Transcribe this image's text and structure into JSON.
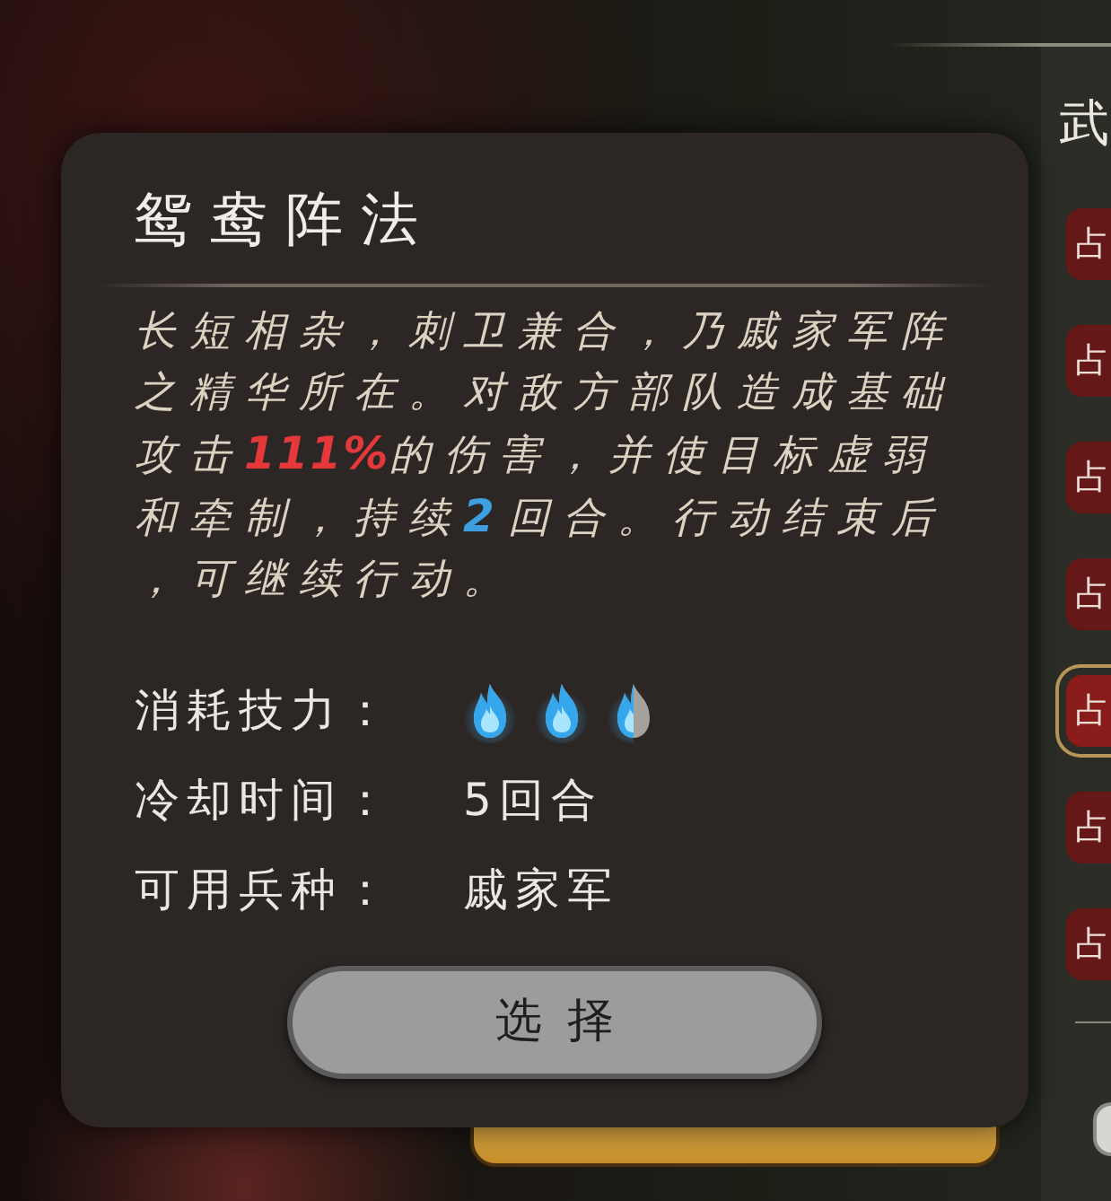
{
  "skill_card": {
    "title": "鸳鸯阵法",
    "description": [
      {
        "kind": "text",
        "text": "长短相杂，刺卫兼合，乃戚家军阵之精华所在。对敌方部队造成基础攻击"
      },
      {
        "kind": "damage",
        "text": "111%"
      },
      {
        "kind": "text",
        "text": "的伤害，并使目标虚弱和牵制，持续"
      },
      {
        "kind": "duration",
        "text": "2"
      },
      {
        "kind": "text",
        "text": "回合。行动结束后，可继续行动。"
      }
    ],
    "stats": [
      {
        "kind": "flames",
        "label": "消耗技力：",
        "flames": [
          {
            "kind": "full"
          },
          {
            "kind": "full"
          },
          {
            "kind": "half"
          }
        ]
      },
      {
        "kind": "text",
        "label": "冷却时间：",
        "value": "5回合"
      },
      {
        "kind": "text",
        "label": "可用兵种：",
        "value": "戚家军"
      }
    ],
    "select_button": "选择"
  },
  "side_panel": {
    "heading": "武",
    "tabs": [
      {
        "label": "占",
        "selected": false
      },
      {
        "label": "占",
        "selected": false
      },
      {
        "label": "占",
        "selected": false
      },
      {
        "label": "占",
        "selected": false
      },
      {
        "label": "占",
        "selected": true
      },
      {
        "label": "占",
        "selected": false
      },
      {
        "label": "占",
        "selected": false
      }
    ]
  }
}
